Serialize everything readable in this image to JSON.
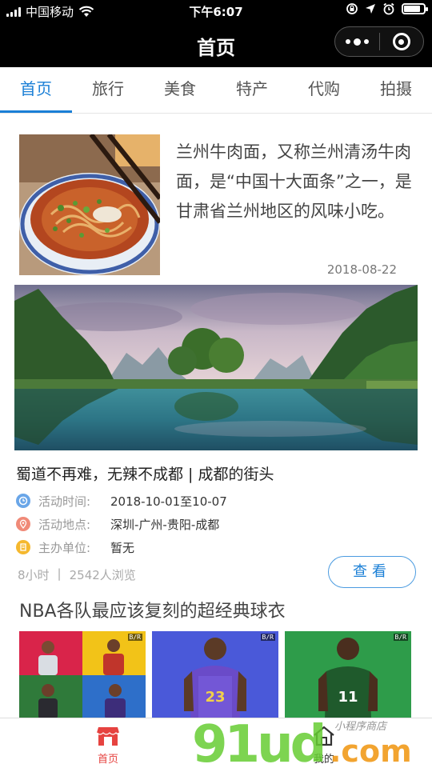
{
  "status_bar": {
    "carrier": "中国移动",
    "time": "下午6:07",
    "battery_level": 0.85
  },
  "nav_bar": {
    "title": "首页",
    "more_icon": "more-dots-icon",
    "close_icon": "record-circle-icon"
  },
  "tabs": [
    {
      "label": "首页",
      "active": true
    },
    {
      "label": "旅行",
      "active": false
    },
    {
      "label": "美食",
      "active": false
    },
    {
      "label": "特产",
      "active": false
    },
    {
      "label": "代购",
      "active": false
    },
    {
      "label": "拍摄",
      "active": false
    }
  ],
  "article": {
    "text": "兰州牛肉面，又称兰州清汤牛肉面，是“中国十大面条”之一，是甘肃省兰州地区的风味小吃。",
    "date": "2018-08-22"
  },
  "event": {
    "title": "蜀道不再难，无辣不成都 | 成都的街头",
    "rows": [
      {
        "label": "活动时间:",
        "value": "2018-10-01至10-07",
        "icon": "clock-icon",
        "color": "#6aa6e8"
      },
      {
        "label": "活动地点:",
        "value": "深圳-广州-贵阳-成都",
        "icon": "location-pin-icon",
        "color": "#f08a78"
      },
      {
        "label": "主办单位:",
        "value": "暂无",
        "icon": "document-icon",
        "color": "#f5b82e"
      }
    ],
    "meta_time": "8小时",
    "meta_separator": "|",
    "meta_views": "2542人浏览",
    "view_button": "查看"
  },
  "section": {
    "title": "NBA各队最应该复刻的超经典球衣",
    "cards": [
      {
        "badge": "B/R",
        "icon": "jersey-collage-image"
      },
      {
        "badge": "B/R",
        "icon": "player-purple-jersey-image"
      },
      {
        "badge": "B/R",
        "icon": "player-green-jersey-image"
      }
    ]
  },
  "bottom_bar": {
    "home_label": "首页",
    "mine_label": "我的",
    "active_color": "#e64340"
  },
  "watermark": {
    "main": "91ud.com",
    "sub": "小程序商店"
  }
}
